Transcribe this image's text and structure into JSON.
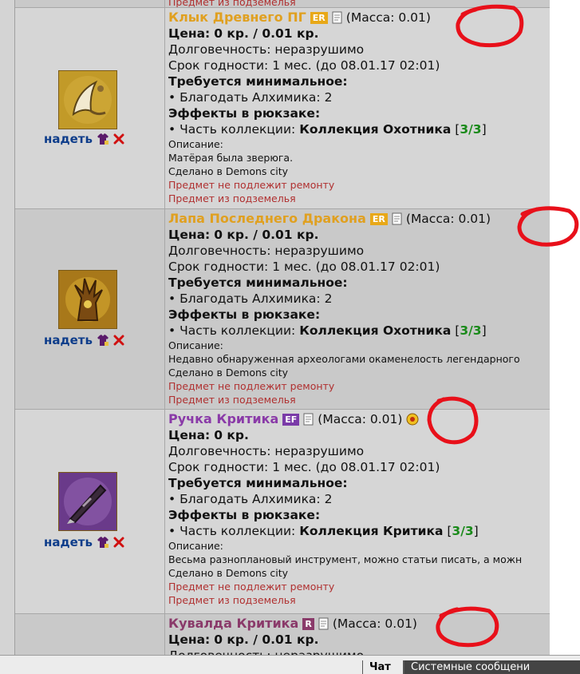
{
  "labels": {
    "price": "Цена:",
    "durability": "Долговечность:",
    "expiry": "Срок годности:",
    "required": "Требуется минимальное:",
    "effects": "Эффекты в рюкзаке:",
    "collection_part": "• Часть коллекции:",
    "description": "Описание:",
    "equip": "надеть"
  },
  "top_partial_text": "Предмет из подземелья",
  "items": [
    {
      "name": "Клык Древнего ПГ",
      "name_color": "#e0a020",
      "badge": "ER",
      "badge_color": "#e8a818",
      "mass": "(Масса: 0.01)",
      "price": "0 кр. / 0.01 кр.",
      "durability": "неразрушимо",
      "expiry": "1 мес. (до 08.01.17 02:01)",
      "requirement": "• Благодать Алхимика: 2",
      "collection": "Коллекция Охотника",
      "collection_count": "3/3",
      "description": "Матёрая была зверюга.",
      "made_in": "Сделано в Demons city",
      "no_repair": "Предмет не подлежит ремонту",
      "dungeon": "Предмет из подземелья",
      "icon": "fang-icon"
    },
    {
      "name": "Лапа Последнего Дракона",
      "name_color": "#e0a020",
      "badge": "ER",
      "badge_color": "#e8a818",
      "mass": "(Масса: 0.01)",
      "price": "0 кр. / 0.01 кр.",
      "durability": "неразрушимо",
      "expiry": "1 мес. (до 08.01.17 02:01)",
      "requirement": "• Благодать Алхимика: 2",
      "collection": "Коллекция Охотника",
      "collection_count": "3/3",
      "description": "Недавно обнаруженная археологами окаменелость легендарного",
      "made_in": "Сделано в Demons city",
      "no_repair": "Предмет не подлежит ремонту",
      "dungeon": "Предмет из подземелья",
      "icon": "dragon-claw-icon"
    },
    {
      "name": "Ручка Критика",
      "name_color": "#8a3aa8",
      "badge": "EF",
      "badge_color": "#7a3aa8",
      "mass": "(Масса: 0.01)",
      "price": "0 кр.",
      "durability": "неразрушимо",
      "expiry": "1 мес. (до 08.01.17 02:01)",
      "requirement": "• Благодать Алхимика: 2",
      "collection": "Коллекция Критика",
      "collection_count": "3/3",
      "description": "Весьма разноплановый инструмент, можно статьи писать, а можн",
      "made_in": "Сделано в Demons city",
      "no_repair": "Предмет не подлежит ремонту",
      "dungeon": "Предмет из подземелья",
      "icon": "pen-icon"
    },
    {
      "name": "Кувалда Критика",
      "name_color": "#8a3a6a",
      "badge": "R",
      "badge_color": "#8a3a6a",
      "mass": "(Масса: 0.01)",
      "price": "0 кр. / 0.01 кр.",
      "durability_partial": "Долговечность: неразрушимо"
    }
  ],
  "bottom_tabs": [
    "Чат",
    "Системные сообщени"
  ],
  "annotation_color": "#e8101a"
}
